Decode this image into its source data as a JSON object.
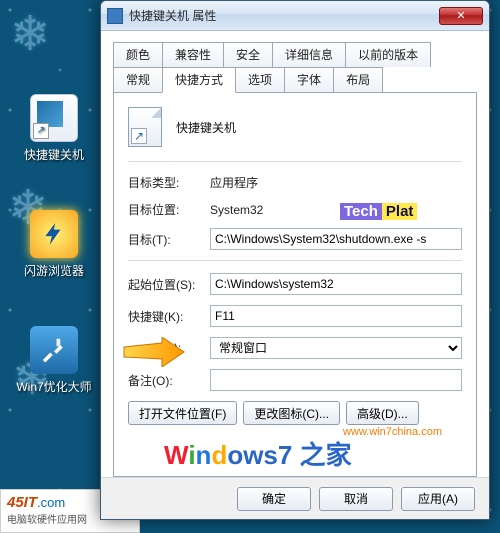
{
  "desktop": {
    "icons": [
      {
        "label": "快捷键关机"
      },
      {
        "label": "闪游浏览器"
      },
      {
        "label": "Win7优化大师"
      }
    ]
  },
  "site_badge": {
    "brand": "45IT",
    "dotcom": ".com",
    "sub": "电脑软硬件应用网"
  },
  "dialog": {
    "title": "快捷键关机 属性",
    "tabs_row1": [
      "颜色",
      "兼容性",
      "安全",
      "详细信息",
      "以前的版本"
    ],
    "tabs_row2": [
      "常规",
      "快捷方式",
      "选项",
      "字体",
      "布局"
    ],
    "active_tab": "快捷方式",
    "header_name": "快捷键关机",
    "fields": {
      "target_type_label": "目标类型:",
      "target_type_value": "应用程序",
      "target_loc_label": "目标位置:",
      "target_loc_value": "System32",
      "target_label": "目标(T):",
      "target_value": "C:\\Windows\\System32\\shutdown.exe -s",
      "startin_label": "起始位置(S):",
      "startin_value": "C:\\Windows\\system32",
      "hotkey_label": "快捷键(K):",
      "hotkey_value": "F11",
      "run_label": "运行方式(R):",
      "run_value": "常规窗口",
      "comment_label": "备注(O):",
      "comment_value": ""
    },
    "buttons": {
      "open_loc": "打开文件位置(F)",
      "change_icon": "更改图标(C)...",
      "advanced": "高级(D)..."
    },
    "footer": {
      "ok": "确定",
      "cancel": "取消",
      "apply": "应用(A)"
    }
  },
  "watermarks": {
    "tech_a": "Tech",
    "tech_b": "Plat",
    "win": "Windows7 之家",
    "url": "www.win7china.com"
  }
}
